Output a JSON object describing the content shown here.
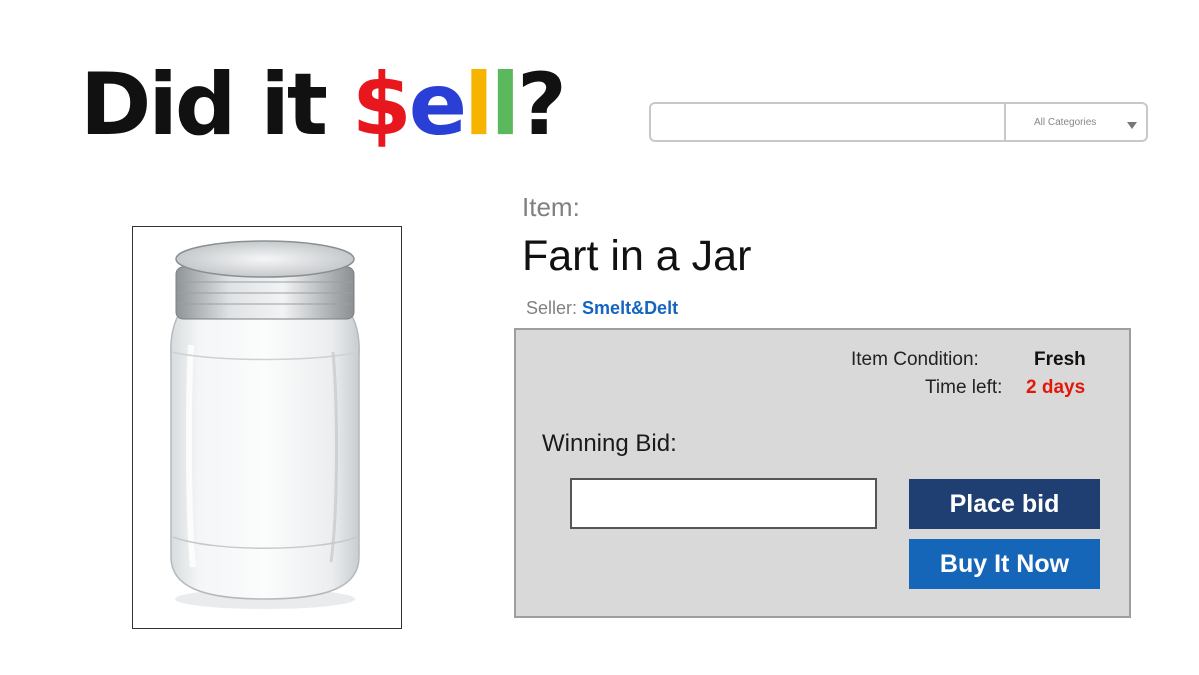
{
  "logo": {
    "part1": "Did it ",
    "dollar": "$",
    "e": "e",
    "l1": "l",
    "l2": "l",
    "question": "?",
    "colors": {
      "base": "#111111",
      "dollar": "#e8171d",
      "e": "#2a3fd6",
      "l1": "#f4b400",
      "l2": "#5cb85c"
    }
  },
  "search": {
    "value": "",
    "category": "All Categories",
    "category_icon": "chevron-down-icon"
  },
  "item": {
    "label": "Item:",
    "title": "Fart in a Jar",
    "seller_label": "Seller:",
    "seller_name": "Smelt&Delt",
    "image_icon": "mason-jar-image"
  },
  "bid_panel": {
    "condition_label": "Item Condition:",
    "condition_value": "Fresh",
    "time_label": "Time left:",
    "time_value": "2 days",
    "winning_bid_label": "Winning Bid:",
    "bid_value": "",
    "place_bid_label": "Place bid",
    "buy_now_label": "Buy It Now"
  }
}
